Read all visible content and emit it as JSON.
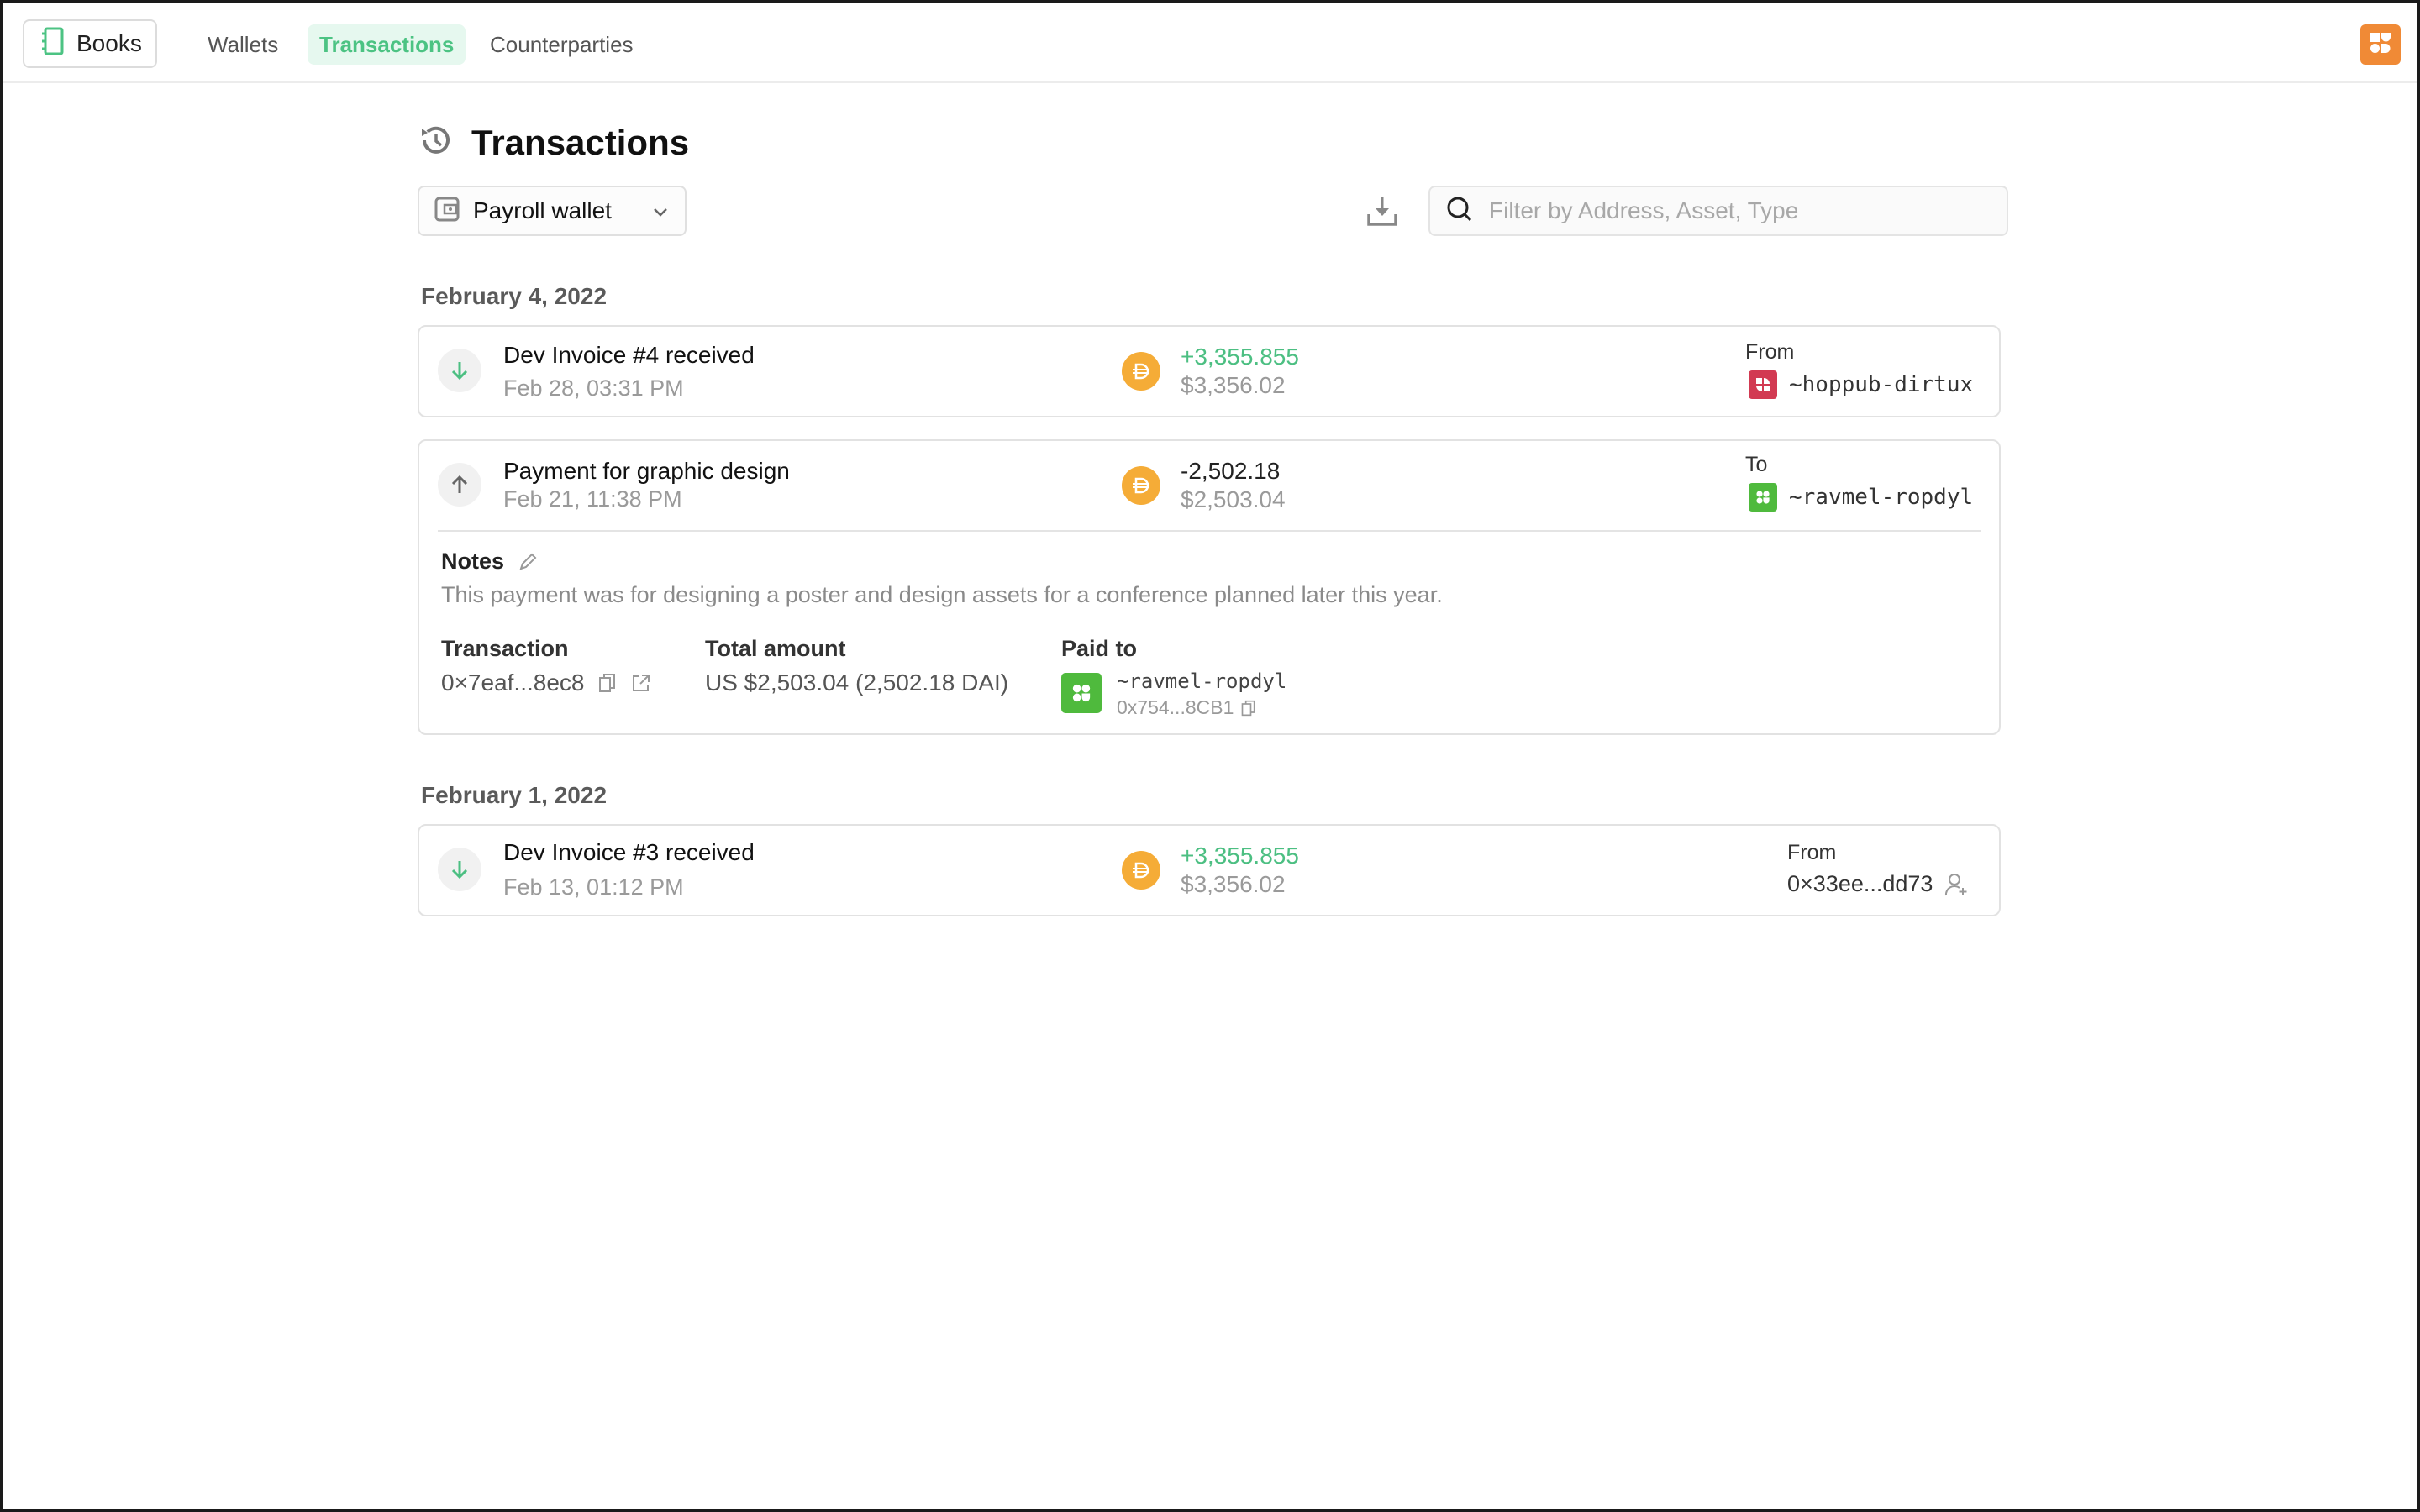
{
  "nav": {
    "books_label": "Books",
    "tabs": [
      {
        "label": "Wallets",
        "active": false
      },
      {
        "label": "Transactions",
        "active": true
      },
      {
        "label": "Counterparties",
        "active": false
      }
    ],
    "accent_color": "#4cc383",
    "app_icon_color": "#f08a36"
  },
  "page": {
    "title": "Transactions",
    "wallet_select": {
      "value": "Payroll wallet"
    },
    "search": {
      "placeholder": "Filter by Address, Asset, Type",
      "value": ""
    }
  },
  "groups": [
    {
      "date": "February 4, 2022",
      "transactions": [
        {
          "title": "Dev Invoice #4 received",
          "datetime": "Feb 28, 03:31 PM",
          "direction": "incoming",
          "asset": "DAI",
          "amount": "+3,355.855",
          "fiat": "$3,356.02",
          "counterparty_label": "From",
          "counterparty": "~hoppub-dirtux",
          "counterparty_color": "#d23a52"
        },
        {
          "title": "Payment for graphic design",
          "datetime": "Feb 21, 11:38 PM",
          "direction": "outgoing",
          "asset": "DAI",
          "amount": "-2,502.18",
          "fiat": "$2,503.04",
          "counterparty_label": "To",
          "counterparty": "~ravmel-ropdyl",
          "counterparty_color": "#4fba3d",
          "expanded": true,
          "details": {
            "notes_label": "Notes",
            "notes": "This payment was for designing a poster and design assets for a conference planned later this year.",
            "transaction_label": "Transaction",
            "transaction_hash": "0×7eaf...8ec8",
            "total_label": "Total amount",
            "total": "US $2,503.04 (2,502.18 DAI)",
            "paid_to_label": "Paid to",
            "paid_to_name": "~ravmel-ropdyl",
            "paid_to_address": "0x754...8CB1"
          }
        }
      ]
    },
    {
      "date": "February 1, 2022",
      "transactions": [
        {
          "title": "Dev Invoice #3 received",
          "datetime": "Feb 13, 01:12 PM",
          "direction": "incoming",
          "asset": "DAI",
          "amount": "+3,355.855",
          "fiat": "$3,356.02",
          "counterparty_label": "From",
          "counterparty": "0×33ee...dd73"
        }
      ]
    }
  ]
}
